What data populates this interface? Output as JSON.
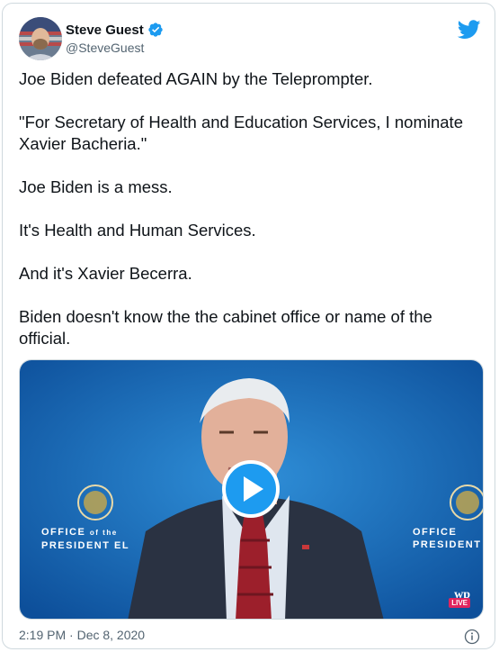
{
  "author": {
    "display_name": "Steve Guest",
    "handle": "@SteveGuest",
    "verified": true
  },
  "tweet": {
    "paragraphs": [
      "Joe Biden defeated AGAIN by the Teleprompter.",
      "\"For Secretary of Health and Education Services, I nominate Xavier Bacheria.\"",
      "Joe Biden is a mess.",
      "It's Health and Human Services.",
      "And it's Xavier Becerra.",
      "Biden doesn't know the the cabinet office or name of the official."
    ],
    "timestamp": "2:19 PM · Dec 8, 2020"
  },
  "media": {
    "type": "video",
    "backdrop_left": "OFFICE of the PRESIDENT ELECT",
    "backdrop_left_line1": "OFFICE",
    "backdrop_left_of": "of the",
    "backdrop_left_line2": "PRESIDENT EL",
    "backdrop_right_line1": "OFFICE",
    "backdrop_right_line2": "PRESIDENT",
    "wp_logo": "wp",
    "live_badge": "LIVE"
  },
  "icons": {
    "brand": "twitter-bird-icon",
    "verified": "verified-badge-icon",
    "play": "play-icon",
    "info": "info-icon"
  },
  "colors": {
    "accent": "#1d9bf0",
    "text": "#0f1419",
    "muted": "#536471",
    "border": "#cfd9de",
    "live": "#e0245e"
  }
}
